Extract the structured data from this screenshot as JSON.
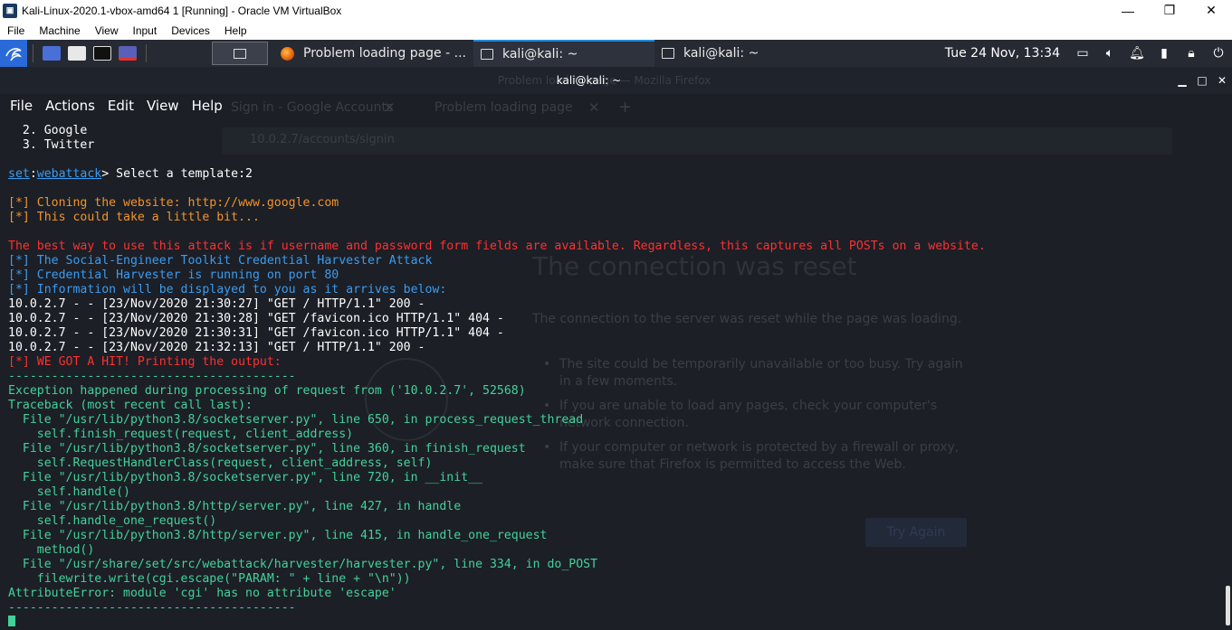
{
  "vbox": {
    "title": "Kali-Linux-2020.1-vbox-amd64 1 [Running] - Oracle VM VirtualBox",
    "menu": [
      "File",
      "Machine",
      "View",
      "Input",
      "Devices",
      "Help"
    ],
    "controls": {
      "minimize": "—",
      "restore": "❐",
      "close": "✕"
    }
  },
  "panel": {
    "tasks": [
      {
        "label": "Problem loading page - ...",
        "icon": "firefox-icon",
        "active": false
      },
      {
        "label": "kali@kali: ~",
        "icon": "terminal-icon",
        "active": true
      },
      {
        "label": "kali@kali: ~",
        "icon": "terminal-icon",
        "active": false
      }
    ],
    "clock": "Tue 24 Nov, 13:34"
  },
  "terminal": {
    "title": "kali@kali: ~",
    "menu": [
      "File",
      "Actions",
      "Edit",
      "View",
      "Help"
    ],
    "lines": [
      {
        "color": "white",
        "text": "  2. Google"
      },
      {
        "color": "white",
        "text": "  3. Twitter"
      },
      {
        "color": "white",
        "text": ""
      },
      {
        "prompt": true,
        "set": "set",
        "module": "webattack",
        "text": "> Select a template:2"
      },
      {
        "color": "white",
        "text": ""
      },
      {
        "color": "orange",
        "text": "[*] Cloning the website: http://www.google.com"
      },
      {
        "color": "orange",
        "text": "[*] This could take a little bit..."
      },
      {
        "color": "white",
        "text": ""
      },
      {
        "color": "red",
        "text": "The best way to use this attack is if username and password form fields are available. Regardless, this captures all POSTs on a website."
      },
      {
        "color": "blue",
        "text": "[*] The Social-Engineer Toolkit Credential Harvester Attack"
      },
      {
        "color": "blue",
        "text": "[*] Credential Harvester is running on port 80"
      },
      {
        "color": "blue",
        "text": "[*] Information will be displayed to you as it arrives below:"
      },
      {
        "color": "white",
        "text": "10.0.2.7 - - [23/Nov/2020 21:30:27] \"GET / HTTP/1.1\" 200 -"
      },
      {
        "color": "white",
        "text": "10.0.2.7 - - [23/Nov/2020 21:30:28] \"GET /favicon.ico HTTP/1.1\" 404 -"
      },
      {
        "color": "white",
        "text": "10.0.2.7 - - [23/Nov/2020 21:30:31] \"GET /favicon.ico HTTP/1.1\" 404 -"
      },
      {
        "color": "white",
        "text": "10.0.2.7 - - [23/Nov/2020 21:32:13] \"GET / HTTP/1.1\" 200 -"
      },
      {
        "color": "red",
        "text": "[*] WE GOT A HIT! Printing the output:"
      },
      {
        "color": "green",
        "text": "----------------------------------------"
      },
      {
        "color": "green",
        "text": "Exception happened during processing of request from ('10.0.2.7', 52568)"
      },
      {
        "color": "green",
        "text": "Traceback (most recent call last):"
      },
      {
        "color": "green",
        "text": "  File \"/usr/lib/python3.8/socketserver.py\", line 650, in process_request_thread"
      },
      {
        "color": "green",
        "text": "    self.finish_request(request, client_address)"
      },
      {
        "color": "green",
        "text": "  File \"/usr/lib/python3.8/socketserver.py\", line 360, in finish_request"
      },
      {
        "color": "green",
        "text": "    self.RequestHandlerClass(request, client_address, self)"
      },
      {
        "color": "green",
        "text": "  File \"/usr/lib/python3.8/socketserver.py\", line 720, in __init__"
      },
      {
        "color": "green",
        "text": "    self.handle()"
      },
      {
        "color": "green",
        "text": "  File \"/usr/lib/python3.8/http/server.py\", line 427, in handle"
      },
      {
        "color": "green",
        "text": "    self.handle_one_request()"
      },
      {
        "color": "green",
        "text": "  File \"/usr/lib/python3.8/http/server.py\", line 415, in handle_one_request"
      },
      {
        "color": "green",
        "text": "    method()"
      },
      {
        "color": "green",
        "text": "  File \"/usr/share/set/src/webattack/harvester/harvester.py\", line 334, in do_POST"
      },
      {
        "color": "green",
        "text": "    filewrite.write(cgi.escape(\"PARAM: \" + line + \"\\n\"))"
      },
      {
        "color": "green",
        "text": "AttributeError: module 'cgi' has no attribute 'escape'"
      },
      {
        "color": "green",
        "text": "----------------------------------------"
      },
      {
        "cursor": true
      }
    ]
  },
  "background_firefox": {
    "window_title": "Problem loading page — Mozilla Firefox",
    "tab1": "Sign in - Google Accounts",
    "tab2": "Problem loading page",
    "url": "10.0.2.7/accounts/signin",
    "heading": "The connection was reset",
    "description": "The connection to the server was reset while the page was loading.",
    "bullets": [
      "The site could be temporarily unavailable or too busy. Try again in a few moments.",
      "If you are unable to load any pages, check your computer's network connection.",
      "If your computer or network is protected by a firewall or proxy, make sure that Firefox is permitted to access the Web."
    ],
    "button": "Try Again"
  },
  "colors": {
    "terminal_bg": "#1c1f26",
    "orange": "#f3932a",
    "red": "#ff3030",
    "blue": "#3a9cf0",
    "green": "#43d19a"
  }
}
